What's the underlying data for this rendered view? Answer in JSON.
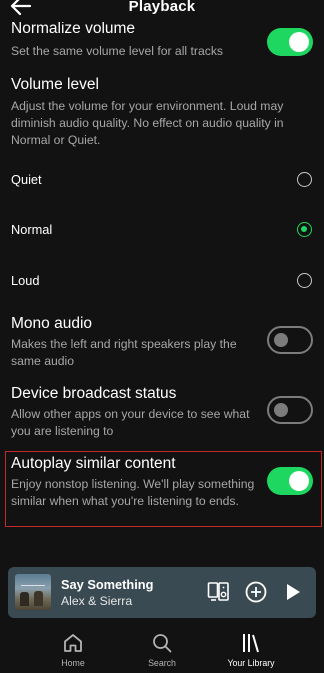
{
  "header": {
    "title": "Playback"
  },
  "normalize": {
    "title": "Normalize volume",
    "description": "Set the same volume level for all tracks",
    "enabled": true
  },
  "volume_level": {
    "title": "Volume level",
    "description": "Adjust the volume for your environment. Loud may diminish audio quality. No effect on audio quality in Normal or Quiet.",
    "options": [
      {
        "label": "Quiet",
        "selected": false
      },
      {
        "label": "Normal",
        "selected": true
      },
      {
        "label": "Loud",
        "selected": false
      }
    ]
  },
  "mono_audio": {
    "title": "Mono audio",
    "description": "Makes the left and right speakers play the same audio",
    "enabled": false
  },
  "device_broadcast": {
    "title": "Device broadcast status",
    "description": "Allow other apps on your device to see what you are listening to",
    "enabled": false
  },
  "autoplay": {
    "title": "Autoplay similar content",
    "description": "Enjoy nonstop listening. We'll play something similar when what you're listening to ends.",
    "enabled": true
  },
  "now_playing": {
    "song": "Say Something",
    "artist": "Alex & Sierra"
  },
  "bottom_nav": [
    {
      "label": "Home",
      "icon": "home-icon",
      "active": false
    },
    {
      "label": "Search",
      "icon": "search-icon",
      "active": false
    },
    {
      "label": "Your Library",
      "icon": "library-icon",
      "active": true
    }
  ],
  "colors": {
    "accent": "#1ed760",
    "background": "#121212",
    "mini_player": "#3a4a52",
    "highlight_border": "#c22a2a"
  }
}
